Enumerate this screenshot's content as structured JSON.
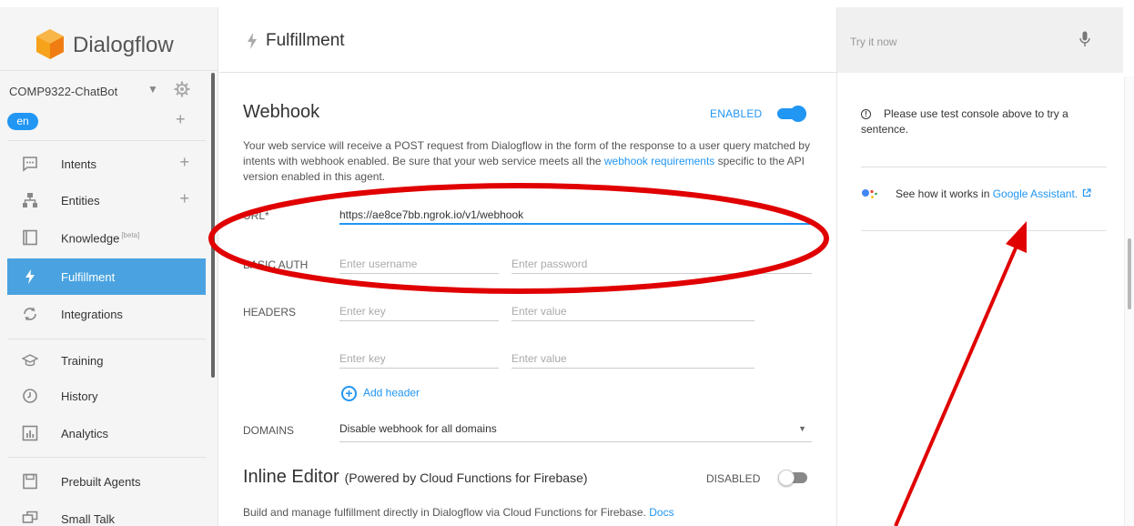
{
  "app": {
    "name": "Dialogflow"
  },
  "agent": {
    "name": "COMP9322-ChatBot",
    "language": "en"
  },
  "sidebar": {
    "items": [
      {
        "label": "Intents",
        "icon": "chat-bubble-icon",
        "has_add": true
      },
      {
        "label": "Entities",
        "icon": "hierarchy-icon",
        "has_add": true
      },
      {
        "label": "Knowledge",
        "badge": "[beta]",
        "icon": "book-icon"
      },
      {
        "label": "Fulfillment",
        "icon": "bolt-icon",
        "active": true
      },
      {
        "label": "Integrations",
        "icon": "integrations-icon"
      },
      {
        "label": "Training",
        "icon": "graduation-cap-icon"
      },
      {
        "label": "History",
        "icon": "clock-icon"
      },
      {
        "label": "Analytics",
        "icon": "bar-chart-icon"
      },
      {
        "label": "Prebuilt Agents",
        "icon": "save-icon"
      },
      {
        "label": "Small Talk",
        "icon": "talk-icon"
      }
    ]
  },
  "header": {
    "title": "Fulfillment"
  },
  "webhook": {
    "title": "Webhook",
    "status": "ENABLED",
    "enabled": true,
    "desc_part1": "Your web service will receive a POST request from Dialogflow in the form of the response to a user query matched by intents with webhook enabled. Be sure that your web service meets all the ",
    "desc_link": "webhook requirements",
    "desc_part2": " specific to the API version enabled in this agent.",
    "url_label": "URL*",
    "url_value": "https://ae8ce7bb.ngrok.io/v1/webhook",
    "basic_auth_label": "BASIC AUTH",
    "username_placeholder": "Enter username",
    "password_placeholder": "Enter password",
    "headers_label": "HEADERS",
    "key_placeholder": "Enter key",
    "value_placeholder": "Enter value",
    "add_header": "Add header",
    "domains_label": "DOMAINS",
    "domains_value": "Disable webhook for all domains"
  },
  "inline_editor": {
    "title": "Inline Editor",
    "subtitle": "(Powered by Cloud Functions for Firebase)",
    "status": "DISABLED",
    "enabled": false,
    "desc": "Build and manage fulfillment directly in Dialogflow via Cloud Functions for Firebase.",
    "docs_link": "Docs"
  },
  "right_panel": {
    "try_placeholder": "Try it now",
    "test_msg": "Please use test console above to try a sentence.",
    "assistant_text": "See how it works in ",
    "assistant_link": "Google Assistant."
  },
  "colors": {
    "accent": "#2196f3",
    "active_nav": "#4aa3e0",
    "annotation": "#e00000",
    "logo": "#f38b1f"
  }
}
